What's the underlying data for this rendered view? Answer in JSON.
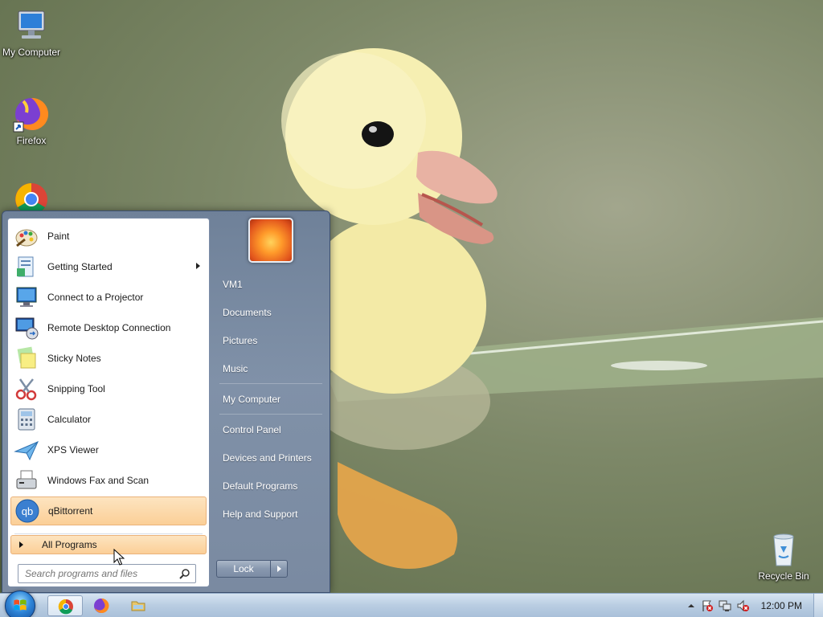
{
  "desktop": {
    "icons": [
      {
        "label": "My Computer",
        "icon": "computer-icon"
      },
      {
        "label": "Firefox",
        "icon": "firefox-icon"
      },
      {
        "label": "",
        "icon": "chrome-icon"
      },
      {
        "label": "Recycle Bin",
        "icon": "recycle-bin-icon"
      }
    ]
  },
  "start_menu": {
    "programs": [
      {
        "label": "Paint",
        "icon": "paint-icon",
        "has_submenu": false
      },
      {
        "label": "Getting Started",
        "icon": "getting-started-icon",
        "has_submenu": true
      },
      {
        "label": "Connect to a Projector",
        "icon": "projector-icon",
        "has_submenu": false
      },
      {
        "label": "Remote Desktop Connection",
        "icon": "remote-desktop-icon",
        "has_submenu": false
      },
      {
        "label": "Sticky Notes",
        "icon": "sticky-notes-icon",
        "has_submenu": false
      },
      {
        "label": "Snipping Tool",
        "icon": "snipping-tool-icon",
        "has_submenu": false
      },
      {
        "label": "Calculator",
        "icon": "calculator-icon",
        "has_submenu": false
      },
      {
        "label": "XPS Viewer",
        "icon": "xps-viewer-icon",
        "has_submenu": false
      },
      {
        "label": "Windows Fax and Scan",
        "icon": "fax-scan-icon",
        "has_submenu": false
      },
      {
        "label": "qBittorrent",
        "icon": "qbittorrent-icon",
        "has_submenu": false,
        "highlighted": true
      }
    ],
    "all_programs_label": "All Programs",
    "search_placeholder": "Search programs and files",
    "right_links": [
      {
        "label": "VM1"
      },
      {
        "label": "Documents"
      },
      {
        "label": "Pictures"
      },
      {
        "label": "Music"
      },
      {
        "label": "My Computer"
      },
      {
        "label": "Control Panel"
      },
      {
        "label": "Devices and Printers"
      },
      {
        "label": "Default Programs"
      },
      {
        "label": "Help and Support"
      }
    ],
    "lock_label": "Lock"
  },
  "taskbar": {
    "pinned": [
      {
        "icon": "chrome-icon",
        "active": true
      },
      {
        "icon": "firefox-icon",
        "active": false
      },
      {
        "icon": "file-explorer-icon",
        "active": false
      }
    ],
    "tray_icons": [
      "show-hidden-icons-chevron",
      "action-center-flag-icon",
      "network-icon",
      "volume-muted-icon"
    ],
    "clock": "12:00 PM"
  },
  "colors": {
    "menu_highlight": "#fbcf97",
    "taskbar": "#b9cde2",
    "start_orb": "#2f86d9"
  }
}
